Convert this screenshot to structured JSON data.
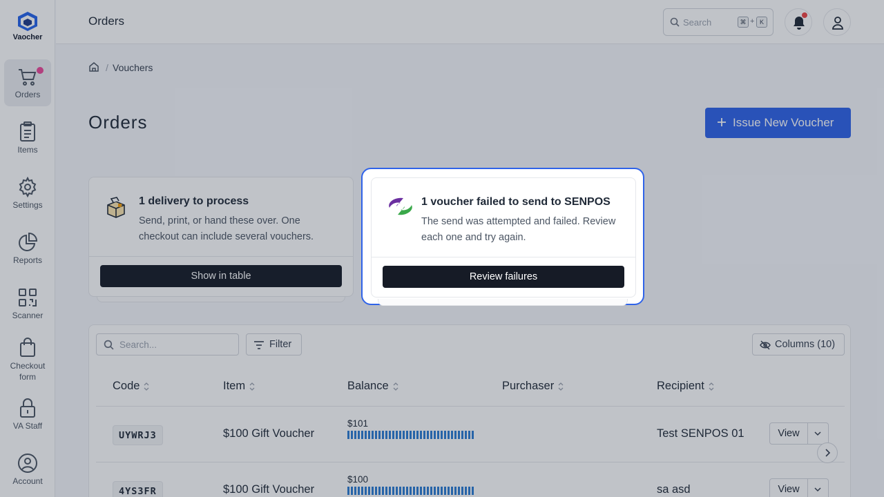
{
  "app": {
    "logo_text": "Vaocher"
  },
  "sidebar": {
    "items": [
      {
        "label": "Orders"
      },
      {
        "label": "Items"
      },
      {
        "label": "Settings"
      },
      {
        "label": "Reports"
      },
      {
        "label": "Scanner"
      },
      {
        "label": "Checkout form"
      },
      {
        "label": "VA Staff"
      },
      {
        "label": "Account"
      }
    ]
  },
  "header": {
    "title": "Orders",
    "search_placeholder": "Search",
    "shortcut_key1": "⌘",
    "shortcut_plus": "+",
    "shortcut_key2": "K"
  },
  "breadcrumb": {
    "current": "Vouchers"
  },
  "page": {
    "title": "Orders",
    "issue_button": "Issue New Voucher"
  },
  "cards": [
    {
      "title": "1 delivery to process",
      "description": "Send, print, or hand these over. One checkout can include several vouchers.",
      "button": "Show in table",
      "icon": "box-icon"
    },
    {
      "title": "1 voucher failed to send to SENPOS",
      "description": "The send was attempted and failed. Review each one and try again.",
      "button": "Review failures",
      "icon": "senpos-logo"
    }
  ],
  "table": {
    "search_placeholder": "Search...",
    "filter_label": "Filter",
    "columns_label": "Columns (10)",
    "headers": [
      "Code",
      "Item",
      "Balance",
      "Purchaser",
      "Recipient"
    ],
    "rows": [
      {
        "code": "UYWRJ3",
        "item": "$100 Gift Voucher",
        "balance": "$101",
        "balance_fraction": 1.0,
        "purchaser": "",
        "recipient": "Test SENPOS 01",
        "action": "View"
      },
      {
        "code": "4YS3FR",
        "item": "$100 Gift Voucher",
        "balance": "$100",
        "balance_fraction": 1.0,
        "purchaser": "",
        "recipient": "sa asd",
        "action": "View"
      }
    ]
  },
  "colors": {
    "accent": "#2f63e9",
    "dark_button": "#161b26",
    "balance_bar": "#2b7cd3",
    "notification_dot": "#ef4444",
    "orders_badge": "#ec4899"
  }
}
